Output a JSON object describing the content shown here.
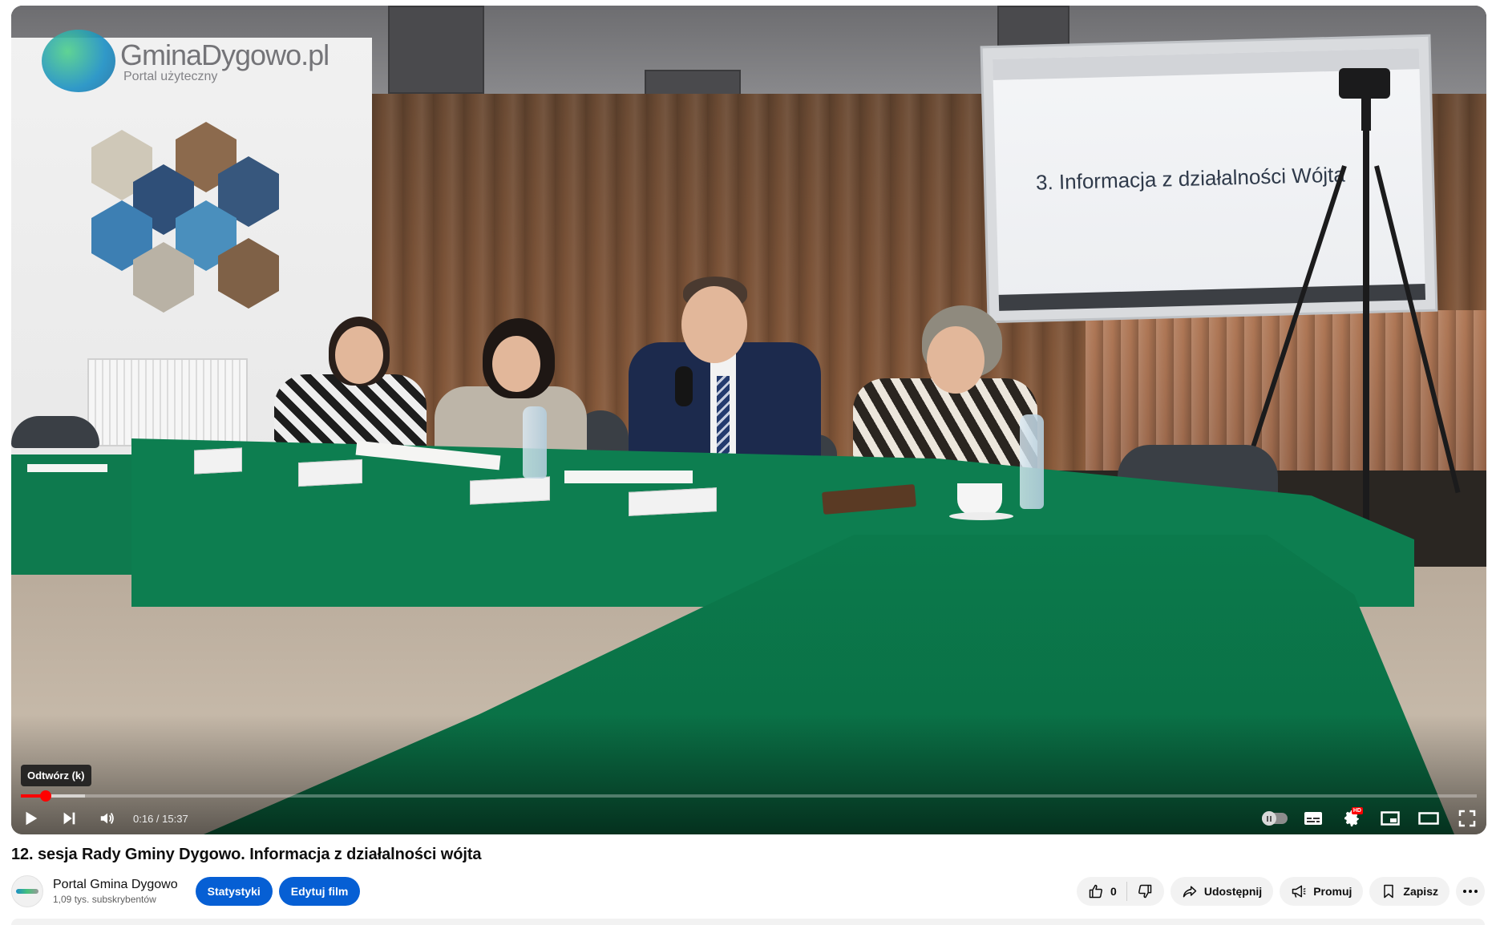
{
  "player": {
    "overlay_logo": {
      "title": "GminaDygowo.pl",
      "subtitle": "Portal użyteczny"
    },
    "projected_slide": "3. Informacja z działalności Wójta",
    "tooltip": "Odtwórz (k)",
    "time_current": "0:16",
    "time_total": "15:37",
    "time_display": "0:16 / 15:37",
    "progress_fraction": 0.017,
    "buffer_fraction": 0.044,
    "quality_badge": "HD",
    "accent_color": "#ff0000",
    "controls_left": [
      "play-icon",
      "next-icon",
      "volume-icon"
    ],
    "controls_right": [
      "autoplay-toggle",
      "subtitles-icon",
      "settings-icon",
      "miniplayer-icon",
      "theater-mode-icon",
      "fullscreen-icon"
    ]
  },
  "video": {
    "title": "12. sesja Rady Gminy Dygowo. Informacja z działalności wójta"
  },
  "channel": {
    "name": "Portal Gmina Dygowo",
    "subscribers": "1,09 tys. subskrybentów"
  },
  "owner_buttons": {
    "stats": "Statystyki",
    "edit": "Edytuj film",
    "color": "#065fd4"
  },
  "actions": {
    "like_count": "0",
    "share": "Udostępnij",
    "promote": "Promuj",
    "save": "Zapisz"
  }
}
